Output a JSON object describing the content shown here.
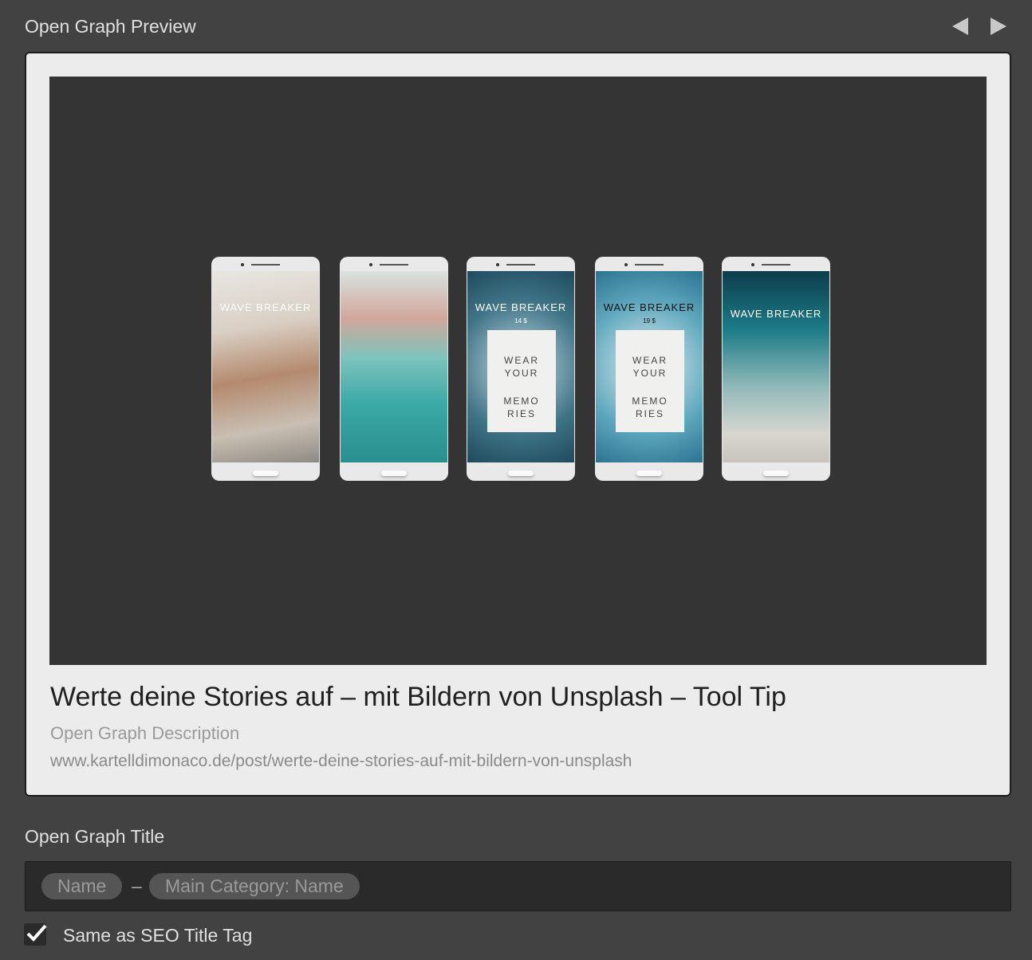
{
  "header": {
    "title": "Open Graph Preview",
    "prev_icon": "triangle-left",
    "next_icon": "triangle-right"
  },
  "preview": {
    "title": "Werte deine Stories auf – mit Bildern von Unsplash – Tool Tip",
    "description": "Open Graph Description",
    "url": "www.kartelldimonaco.de/post/werte-deine-stories-auf-mit-bildern-von-unsplash",
    "phones": [
      {
        "headline": "WAVE BREAKER",
        "price": "",
        "tag": []
      },
      {
        "headline": "",
        "price": "",
        "tag": []
      },
      {
        "headline": "WAVE BREAKER",
        "price": "14 $",
        "tag": [
          "WEAR",
          "YOUR",
          "",
          "MEMO",
          "RIES"
        ]
      },
      {
        "headline": "WAVE BREAKER",
        "price": "19 $",
        "tag": [
          "WEAR",
          "YOUR",
          "",
          "MEMO",
          "RIES"
        ]
      },
      {
        "headline": "WAVE BREAKER",
        "price": "",
        "tag": []
      }
    ]
  },
  "og_title": {
    "label": "Open Graph Title",
    "tokens": [
      "Name",
      "Main Category: Name"
    ],
    "separator": "–"
  },
  "checkbox": {
    "label": "Same as SEO Title Tag",
    "checked": true
  }
}
